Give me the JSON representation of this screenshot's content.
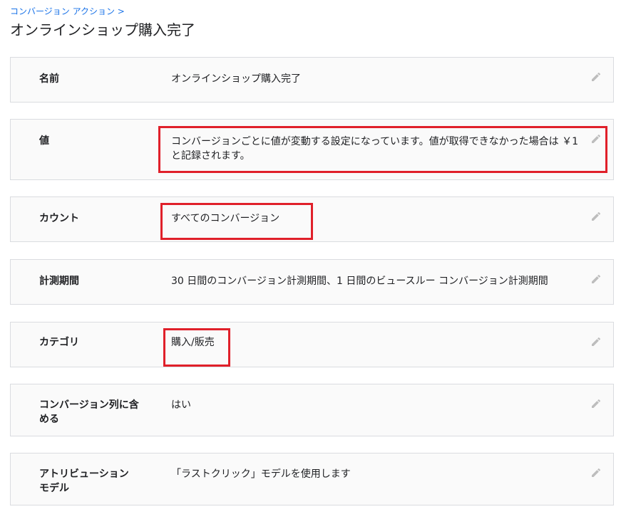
{
  "breadcrumb": "コンバージョン アクション >",
  "title": "オンラインショップ購入完了",
  "rows": [
    {
      "label": "名前",
      "value": "オンラインショップ購入完了"
    },
    {
      "label": "値",
      "value": "コンバージョンごとに値が変動する設定になっています。値が取得できなかった場合は ￥1 と記録されます。"
    },
    {
      "label": "カウント",
      "value": "すべてのコンバージョン"
    },
    {
      "label": "計測期間",
      "value": "30 日間のコンバージョン計測期間、1 日間のビュースルー コンバージョン計測期間"
    },
    {
      "label": "カテゴリ",
      "value": "購入/販売"
    },
    {
      "label": "コンバージョン列に含める",
      "value": "はい"
    },
    {
      "label": "アトリビューション モデル",
      "value": "「ラストクリック」モデルを使用します"
    }
  ],
  "colors": {
    "accent": "#1a73e8",
    "highlight": "#e0202a",
    "card_bg": "#fafafa",
    "border": "#dadce0",
    "icon": "#bdbdbd"
  },
  "icons": {
    "edit": "pencil-icon"
  }
}
